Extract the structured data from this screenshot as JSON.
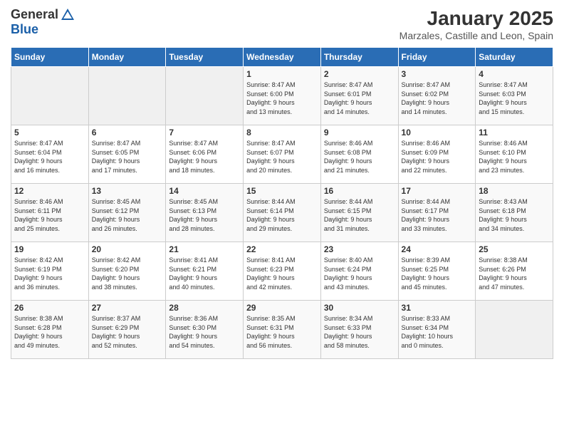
{
  "header": {
    "logo_general": "General",
    "logo_blue": "Blue",
    "month_title": "January 2025",
    "subtitle": "Marzales, Castille and Leon, Spain"
  },
  "days_of_week": [
    "Sunday",
    "Monday",
    "Tuesday",
    "Wednesday",
    "Thursday",
    "Friday",
    "Saturday"
  ],
  "weeks": [
    [
      {
        "day": "",
        "info": ""
      },
      {
        "day": "",
        "info": ""
      },
      {
        "day": "",
        "info": ""
      },
      {
        "day": "1",
        "info": "Sunrise: 8:47 AM\nSunset: 6:00 PM\nDaylight: 9 hours\nand 13 minutes."
      },
      {
        "day": "2",
        "info": "Sunrise: 8:47 AM\nSunset: 6:01 PM\nDaylight: 9 hours\nand 14 minutes."
      },
      {
        "day": "3",
        "info": "Sunrise: 8:47 AM\nSunset: 6:02 PM\nDaylight: 9 hours\nand 14 minutes."
      },
      {
        "day": "4",
        "info": "Sunrise: 8:47 AM\nSunset: 6:03 PM\nDaylight: 9 hours\nand 15 minutes."
      }
    ],
    [
      {
        "day": "5",
        "info": "Sunrise: 8:47 AM\nSunset: 6:04 PM\nDaylight: 9 hours\nand 16 minutes."
      },
      {
        "day": "6",
        "info": "Sunrise: 8:47 AM\nSunset: 6:05 PM\nDaylight: 9 hours\nand 17 minutes."
      },
      {
        "day": "7",
        "info": "Sunrise: 8:47 AM\nSunset: 6:06 PM\nDaylight: 9 hours\nand 18 minutes."
      },
      {
        "day": "8",
        "info": "Sunrise: 8:47 AM\nSunset: 6:07 PM\nDaylight: 9 hours\nand 20 minutes."
      },
      {
        "day": "9",
        "info": "Sunrise: 8:46 AM\nSunset: 6:08 PM\nDaylight: 9 hours\nand 21 minutes."
      },
      {
        "day": "10",
        "info": "Sunrise: 8:46 AM\nSunset: 6:09 PM\nDaylight: 9 hours\nand 22 minutes."
      },
      {
        "day": "11",
        "info": "Sunrise: 8:46 AM\nSunset: 6:10 PM\nDaylight: 9 hours\nand 23 minutes."
      }
    ],
    [
      {
        "day": "12",
        "info": "Sunrise: 8:46 AM\nSunset: 6:11 PM\nDaylight: 9 hours\nand 25 minutes."
      },
      {
        "day": "13",
        "info": "Sunrise: 8:45 AM\nSunset: 6:12 PM\nDaylight: 9 hours\nand 26 minutes."
      },
      {
        "day": "14",
        "info": "Sunrise: 8:45 AM\nSunset: 6:13 PM\nDaylight: 9 hours\nand 28 minutes."
      },
      {
        "day": "15",
        "info": "Sunrise: 8:44 AM\nSunset: 6:14 PM\nDaylight: 9 hours\nand 29 minutes."
      },
      {
        "day": "16",
        "info": "Sunrise: 8:44 AM\nSunset: 6:15 PM\nDaylight: 9 hours\nand 31 minutes."
      },
      {
        "day": "17",
        "info": "Sunrise: 8:44 AM\nSunset: 6:17 PM\nDaylight: 9 hours\nand 33 minutes."
      },
      {
        "day": "18",
        "info": "Sunrise: 8:43 AM\nSunset: 6:18 PM\nDaylight: 9 hours\nand 34 minutes."
      }
    ],
    [
      {
        "day": "19",
        "info": "Sunrise: 8:42 AM\nSunset: 6:19 PM\nDaylight: 9 hours\nand 36 minutes."
      },
      {
        "day": "20",
        "info": "Sunrise: 8:42 AM\nSunset: 6:20 PM\nDaylight: 9 hours\nand 38 minutes."
      },
      {
        "day": "21",
        "info": "Sunrise: 8:41 AM\nSunset: 6:21 PM\nDaylight: 9 hours\nand 40 minutes."
      },
      {
        "day": "22",
        "info": "Sunrise: 8:41 AM\nSunset: 6:23 PM\nDaylight: 9 hours\nand 42 minutes."
      },
      {
        "day": "23",
        "info": "Sunrise: 8:40 AM\nSunset: 6:24 PM\nDaylight: 9 hours\nand 43 minutes."
      },
      {
        "day": "24",
        "info": "Sunrise: 8:39 AM\nSunset: 6:25 PM\nDaylight: 9 hours\nand 45 minutes."
      },
      {
        "day": "25",
        "info": "Sunrise: 8:38 AM\nSunset: 6:26 PM\nDaylight: 9 hours\nand 47 minutes."
      }
    ],
    [
      {
        "day": "26",
        "info": "Sunrise: 8:38 AM\nSunset: 6:28 PM\nDaylight: 9 hours\nand 49 minutes."
      },
      {
        "day": "27",
        "info": "Sunrise: 8:37 AM\nSunset: 6:29 PM\nDaylight: 9 hours\nand 52 minutes."
      },
      {
        "day": "28",
        "info": "Sunrise: 8:36 AM\nSunset: 6:30 PM\nDaylight: 9 hours\nand 54 minutes."
      },
      {
        "day": "29",
        "info": "Sunrise: 8:35 AM\nSunset: 6:31 PM\nDaylight: 9 hours\nand 56 minutes."
      },
      {
        "day": "30",
        "info": "Sunrise: 8:34 AM\nSunset: 6:33 PM\nDaylight: 9 hours\nand 58 minutes."
      },
      {
        "day": "31",
        "info": "Sunrise: 8:33 AM\nSunset: 6:34 PM\nDaylight: 10 hours\nand 0 minutes."
      },
      {
        "day": "",
        "info": ""
      }
    ]
  ]
}
